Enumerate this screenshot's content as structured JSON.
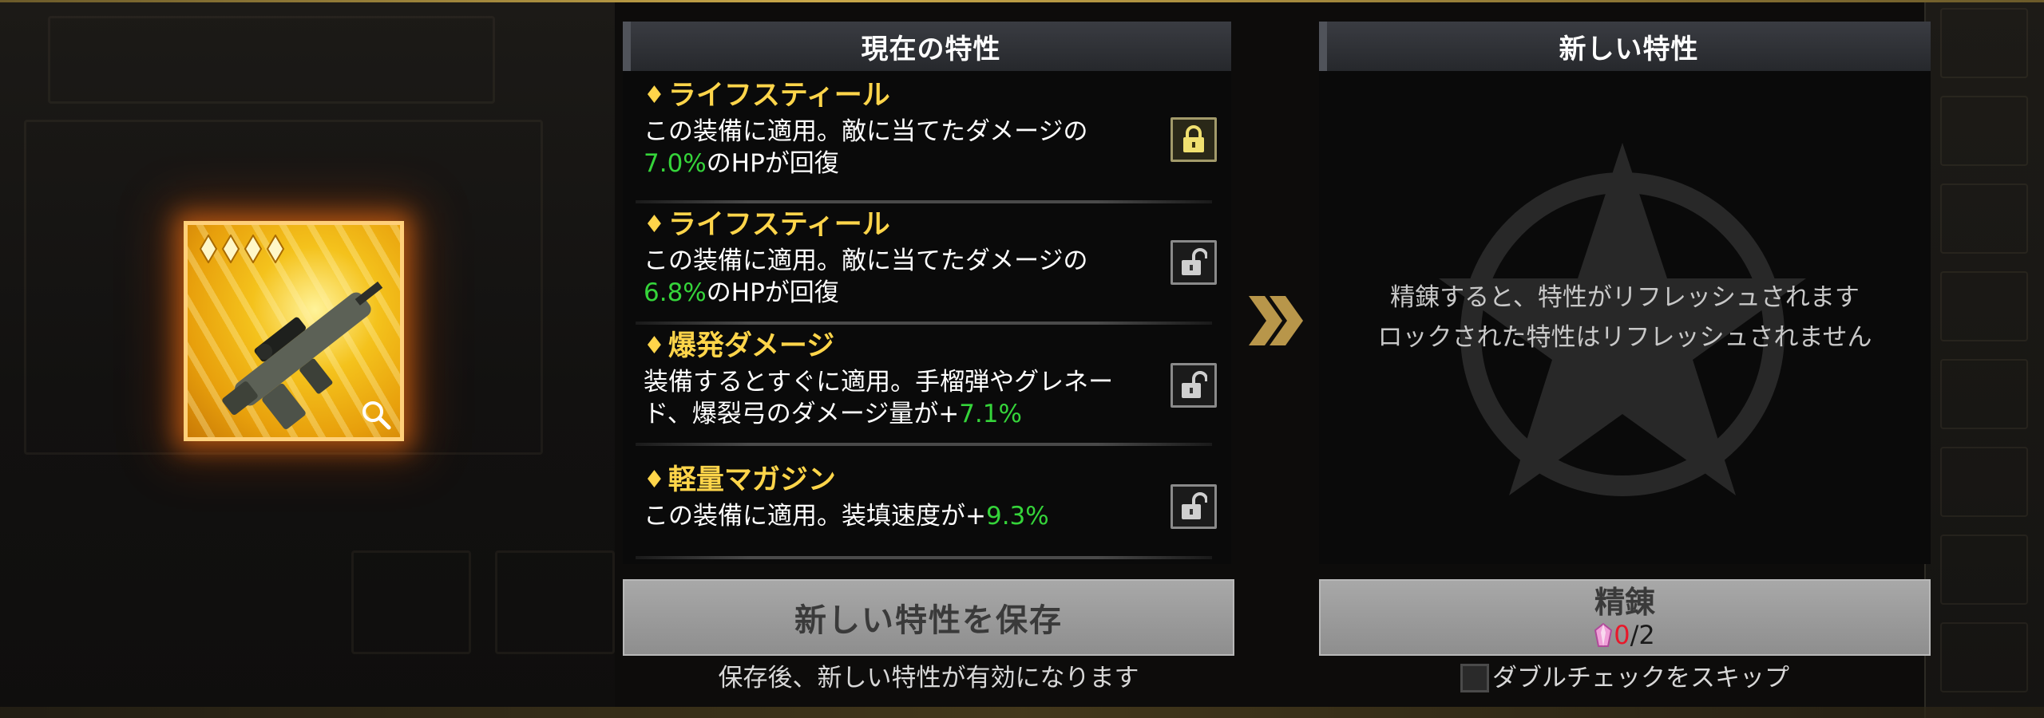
{
  "item": {
    "stars": 4,
    "rarity_color": "#f4c21c",
    "icons": [
      "star-icon",
      "rifle-icon",
      "magnifier-icon"
    ]
  },
  "current_panel": {
    "title": "現在の特性",
    "traits": [
      {
        "name": "ライフスティール",
        "desc_before": "この装備に適用。敵に当てたダメージの",
        "value": "7.0%",
        "desc_after": "のHPが回復",
        "locked": true
      },
      {
        "name": "ライフスティール",
        "desc_before": "この装備に適用。敵に当てたダメージの",
        "value": "6.8%",
        "desc_after": "のHPが回復",
        "locked": false
      },
      {
        "name": "爆発ダメージ",
        "desc_before": "装備するとすぐに適用。手榴弾やグレネード、爆裂弓のダメージ量が+",
        "value": "7.1%",
        "desc_after": "",
        "locked": false
      },
      {
        "name": "軽量マガジン",
        "desc_before": "この装備に適用。装填速度が+",
        "value": "9.3%",
        "desc_after": "",
        "locked": false
      }
    ]
  },
  "new_panel": {
    "title": "新しい特性",
    "empty_line1": "精錬すると、特性がリフレッシュされます",
    "empty_line2": "ロックされた特性はリフレッシュされません"
  },
  "save_button": {
    "label": "新しい特性を保存",
    "note": "保存後、新しい特性が有効になります"
  },
  "refine_button": {
    "label": "精錬",
    "cost_current": "0",
    "cost_total": "/2"
  },
  "skip_check": {
    "label": "ダブルチェックをスキップ",
    "checked": false
  },
  "colors": {
    "accent_gold": "#ffd54a",
    "value_green": "#35d43a",
    "cost_red": "#e8182a"
  }
}
